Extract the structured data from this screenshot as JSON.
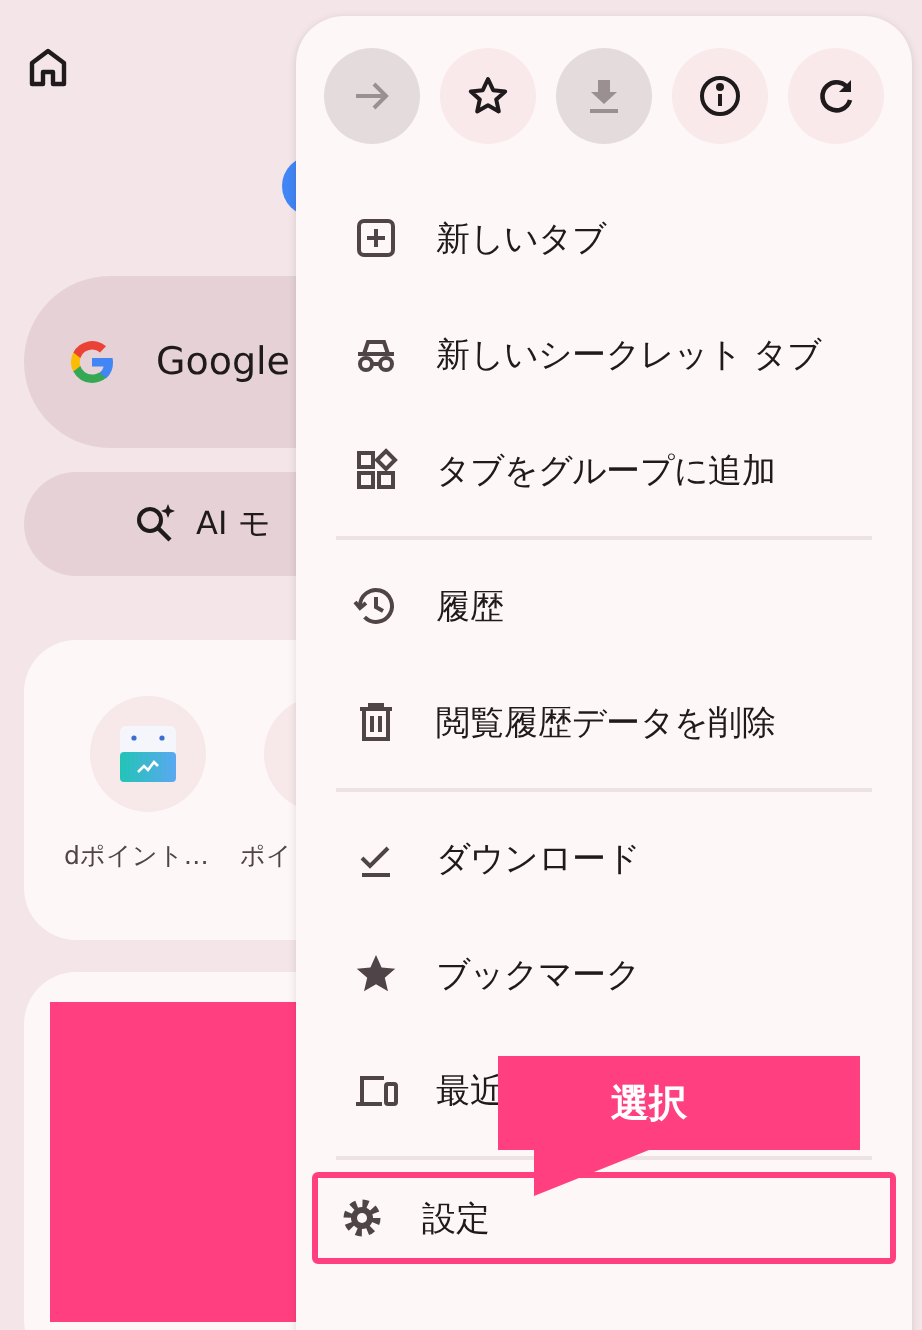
{
  "page": {
    "search_pill": {
      "label": "Google"
    },
    "ai_pill": {
      "label": "AI モ"
    },
    "shortcuts": [
      {
        "label": "dポイント…"
      },
      {
        "label": "ポイ"
      }
    ]
  },
  "menu": {
    "icon_buttons": [
      {
        "disabled": true
      },
      {
        "disabled": false
      },
      {
        "disabled": true
      },
      {
        "disabled": false
      },
      {
        "disabled": false
      }
    ],
    "items": [
      {
        "kind": "item",
        "label": "新しいタブ",
        "highlighted": false
      },
      {
        "kind": "item",
        "label": "新しいシークレット タブ",
        "highlighted": false
      },
      {
        "kind": "item",
        "label": "タブをグループに追加",
        "highlighted": false
      },
      {
        "kind": "divider"
      },
      {
        "kind": "item",
        "label": "履歴",
        "highlighted": false
      },
      {
        "kind": "item",
        "label": "閲覧履歴データを削除",
        "highlighted": false
      },
      {
        "kind": "divider"
      },
      {
        "kind": "item",
        "label": "ダウンロード",
        "highlighted": false
      },
      {
        "kind": "item",
        "label": "ブックマーク",
        "highlighted": false
      },
      {
        "kind": "item",
        "label": "最近",
        "highlighted": false
      },
      {
        "kind": "divider"
      },
      {
        "kind": "item",
        "label": "設定",
        "highlighted": true
      }
    ]
  },
  "callout": {
    "text": "選択"
  }
}
